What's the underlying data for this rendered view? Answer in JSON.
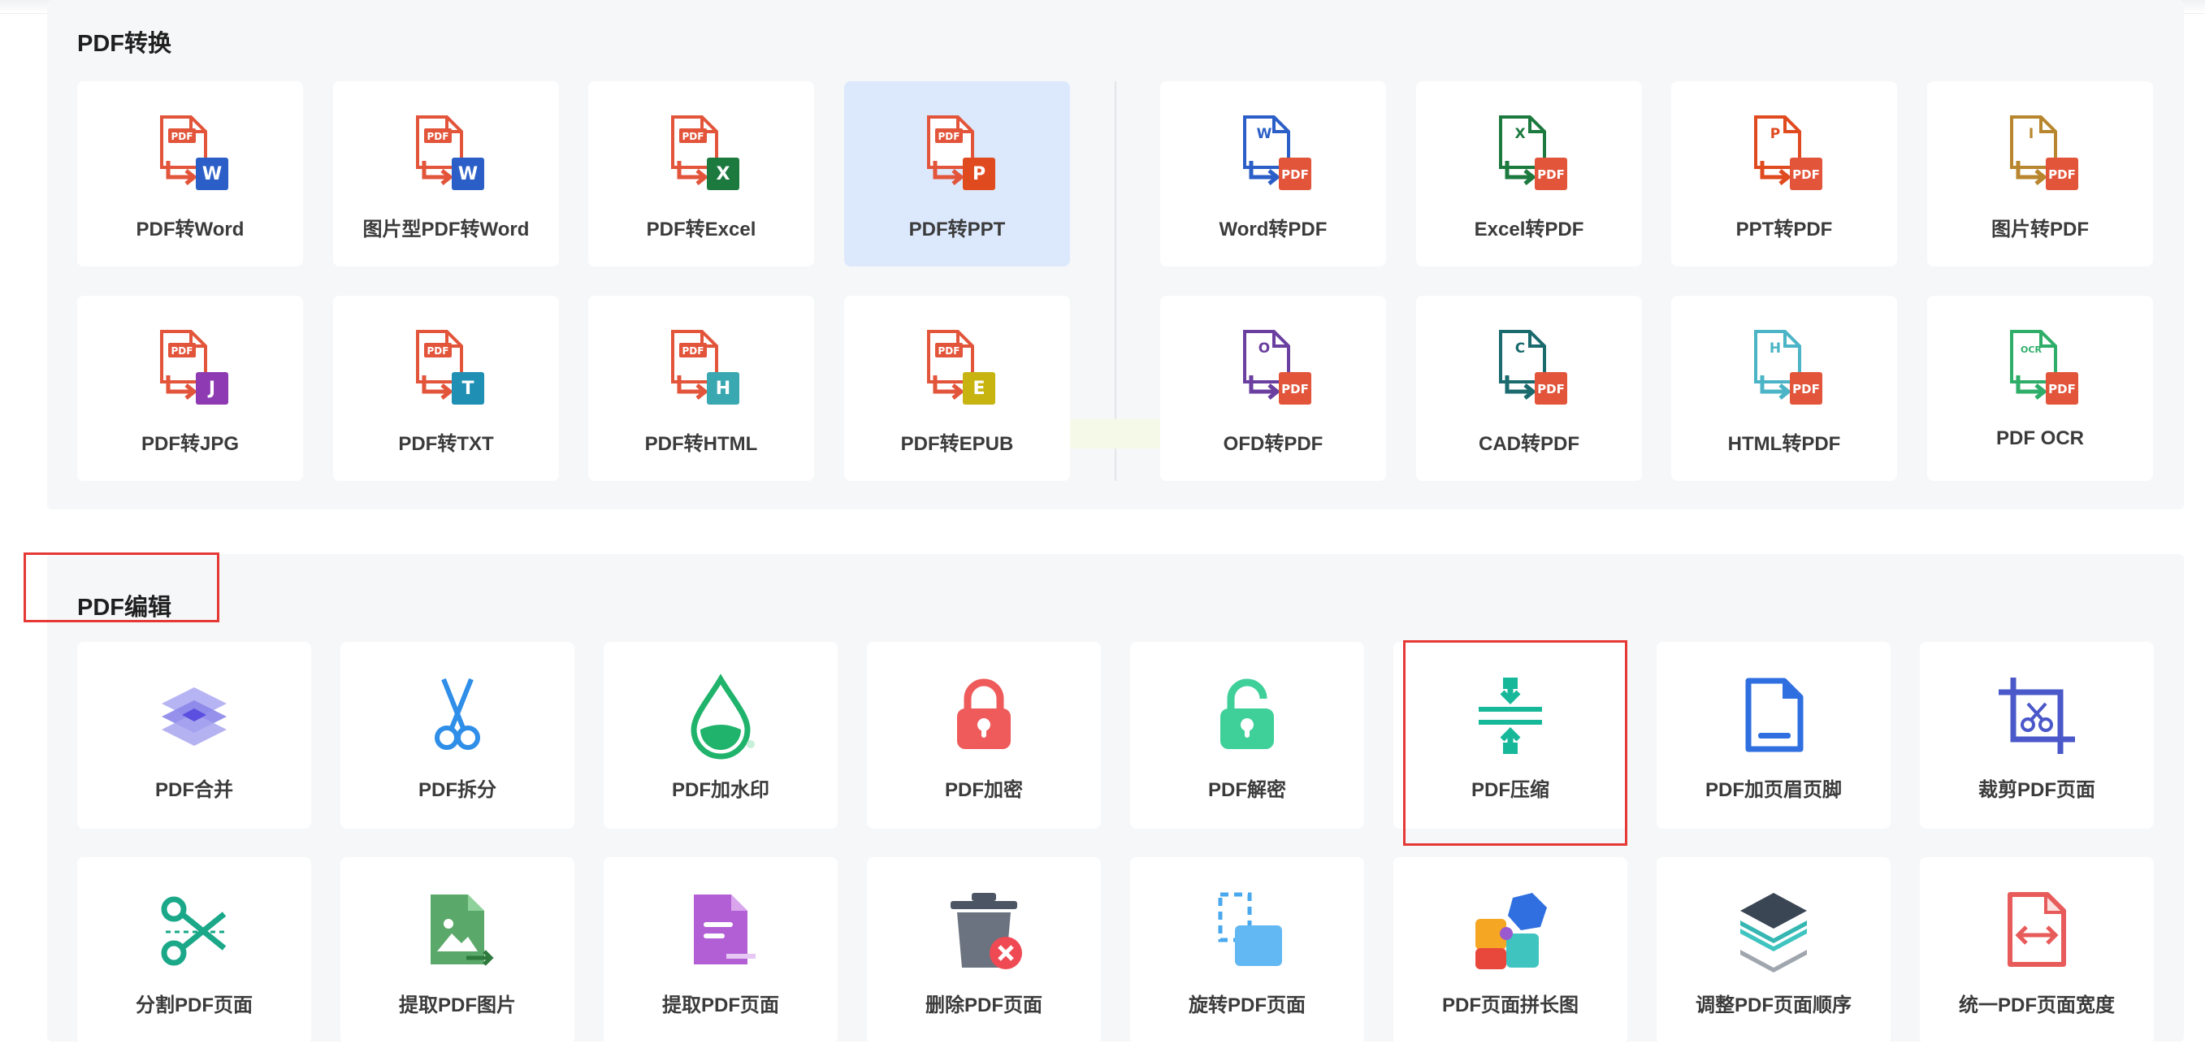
{
  "convert": {
    "title": "PDF转换",
    "cards": [
      {
        "label": "PDF转Word",
        "icon": "pdf-to-word-icon",
        "badge": "W",
        "color": "#2b5fc7"
      },
      {
        "label": "图片型PDF转Word",
        "icon": "image-pdf-to-word-icon",
        "badge": "W",
        "color": "#2b5fc7"
      },
      {
        "label": "PDF转Excel",
        "icon": "pdf-to-excel-icon",
        "badge": "X",
        "color": "#1d7a3f"
      },
      {
        "label": "PDF转PPT",
        "icon": "pdf-to-ppt-icon",
        "badge": "P",
        "color": "#e04a1f"
      },
      {
        "label": "Word转PDF",
        "icon": "word-to-pdf-icon",
        "badge": "W",
        "color": "#2b5fc7"
      },
      {
        "label": "Excel转PDF",
        "icon": "excel-to-pdf-icon",
        "badge": "X",
        "color": "#1d7a3f"
      },
      {
        "label": "PPT转PDF",
        "icon": "ppt-to-pdf-icon",
        "badge": "P",
        "color": "#e04a1f"
      },
      {
        "label": "图片转PDF",
        "icon": "image-to-pdf-icon",
        "badge": "I",
        "color": "#b8862e"
      },
      {
        "label": "PDF转JPG",
        "icon": "pdf-to-jpg-icon",
        "badge": "J",
        "color": "#8e3bb3"
      },
      {
        "label": "PDF转TXT",
        "icon": "pdf-to-txt-icon",
        "badge": "T",
        "color": "#1f8fb4"
      },
      {
        "label": "PDF转HTML",
        "icon": "pdf-to-html-icon",
        "badge": "H",
        "color": "#39a8b0"
      },
      {
        "label": "PDF转EPUB",
        "icon": "pdf-to-epub-icon",
        "badge": "E",
        "color": "#c7b410"
      },
      {
        "label": "OFD转PDF",
        "icon": "ofd-to-pdf-icon",
        "badge": "O",
        "color": "#6a3fa0"
      },
      {
        "label": "CAD转PDF",
        "icon": "cad-to-pdf-icon",
        "badge": "C",
        "color": "#1a6a6e"
      },
      {
        "label": "HTML转PDF",
        "icon": "html-to-pdf-icon",
        "badge": "H",
        "color": "#4bb4c6"
      },
      {
        "label": "PDF OCR",
        "icon": "pdf-ocr-icon",
        "badge": "OCR",
        "color": "#2fae6a"
      }
    ],
    "active_label": "PDF转PPT",
    "pdf_tag": "PDF"
  },
  "edit": {
    "title": "PDF编辑",
    "cards": [
      {
        "label": "PDF合并",
        "icon": "layers-merge-icon"
      },
      {
        "label": "PDF拆分",
        "icon": "scissors-icon"
      },
      {
        "label": "PDF加水印",
        "icon": "water-drop-icon"
      },
      {
        "label": "PDF加密",
        "icon": "lock-icon"
      },
      {
        "label": "PDF解密",
        "icon": "unlock-icon"
      },
      {
        "label": "PDF压缩",
        "icon": "compress-icon"
      },
      {
        "label": "PDF加页眉页脚",
        "icon": "header-footer-icon"
      },
      {
        "label": "裁剪PDF页面",
        "icon": "crop-icon"
      },
      {
        "label": "分割PDF页面",
        "icon": "split-page-icon"
      },
      {
        "label": "提取PDF图片",
        "icon": "extract-image-icon"
      },
      {
        "label": "提取PDF页面",
        "icon": "extract-page-icon"
      },
      {
        "label": "删除PDF页面",
        "icon": "trash-delete-icon"
      },
      {
        "label": "旋转PDF页面",
        "icon": "rotate-page-icon"
      },
      {
        "label": "PDF页面拼长图",
        "icon": "puzzle-icon"
      },
      {
        "label": "调整PDF页面顺序",
        "icon": "reorder-layers-icon"
      },
      {
        "label": "统一PDF页面宽度",
        "icon": "uniform-width-icon"
      }
    ]
  },
  "colors": {
    "pdf_red": "#e2553b",
    "teal": "#17b89a",
    "highlight": "#e53935",
    "active_bg": "#dce9fd"
  }
}
